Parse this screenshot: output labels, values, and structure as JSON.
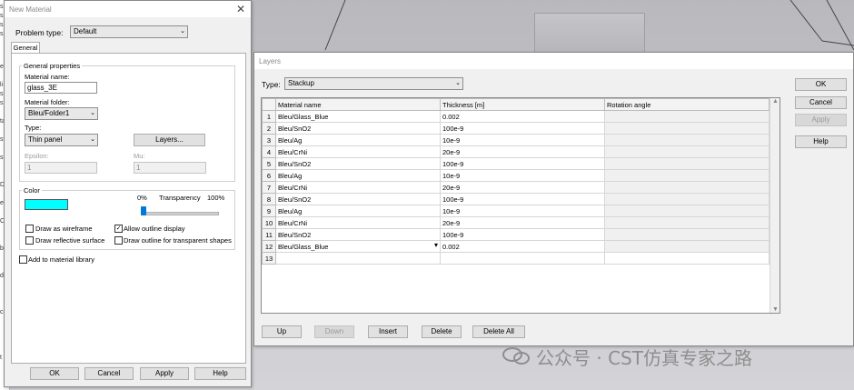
{
  "new_material": {
    "title": "New Material",
    "problem_type_label": "Problem type:",
    "problem_type_value": "Default",
    "tab_general": "General",
    "general_properties": "General properties",
    "material_name_label": "Material name:",
    "material_name_value": "glass_3E",
    "material_folder_label": "Material folder:",
    "material_folder_value": "Bleu/Folder1",
    "type_label": "Type:",
    "type_value": "Thin panel",
    "layers_button": "Layers...",
    "epsilon_label": "Epsilon:",
    "epsilon_value": "1",
    "mu_label": "Mu:",
    "mu_value": "1",
    "color_group": "Color",
    "swatch_color": "#00ffff",
    "transparency_min": "0%",
    "transparency_label": "Transparency",
    "transparency_max": "100%",
    "transparency_fraction": 0.0,
    "draw_wireframe": "Draw as wireframe",
    "draw_wireframe_checked": false,
    "allow_outline": "Allow outline display",
    "allow_outline_checked": true,
    "draw_reflective": "Draw reflective surface",
    "draw_reflective_checked": false,
    "draw_outline_transparent": "Draw outline for transparent shapes",
    "draw_outline_transparent_checked": false,
    "add_to_library": "Add to material library",
    "add_to_library_checked": false,
    "ok": "OK",
    "cancel": "Cancel",
    "apply": "Apply",
    "help": "Help"
  },
  "layers": {
    "title": "Layers",
    "type_label": "Type:",
    "type_value": "Stackup",
    "columns": [
      "Material name",
      "Thickness [m]",
      "Rotation angle"
    ],
    "rows": [
      {
        "n": "1",
        "name": "Bleu/Glass_Blue",
        "thickness": "0.002"
      },
      {
        "n": "2",
        "name": "Bleu/SnO2",
        "thickness": "100e-9"
      },
      {
        "n": "3",
        "name": "Bleu/Ag",
        "thickness": "10e-9"
      },
      {
        "n": "4",
        "name": "Bleu/CrNi",
        "thickness": "20e-9"
      },
      {
        "n": "5",
        "name": "Bleu/SnO2",
        "thickness": "100e-9"
      },
      {
        "n": "6",
        "name": "Bleu/Ag",
        "thickness": "10e-9"
      },
      {
        "n": "7",
        "name": "Bleu/CrNi",
        "thickness": "20e-9"
      },
      {
        "n": "8",
        "name": "Bleu/SnO2",
        "thickness": "100e-9"
      },
      {
        "n": "9",
        "name": "Bleu/Ag",
        "thickness": "10e-9"
      },
      {
        "n": "10",
        "name": "Bleu/CrNi",
        "thickness": "20e-9"
      },
      {
        "n": "11",
        "name": "Bleu/SnO2",
        "thickness": "100e-9"
      },
      {
        "n": "12",
        "name": "Bleu/Glass_Blue",
        "thickness": "0.002"
      },
      {
        "n": "13",
        "name": "",
        "thickness": ""
      }
    ],
    "up": "Up",
    "down": "Down",
    "insert": "Insert",
    "delete": "Delete",
    "delete_all": "Delete All",
    "ok": "OK",
    "cancel": "Cancel",
    "apply": "Apply",
    "help": "Help"
  },
  "watermark": "公众号 · CST仿真专家之路"
}
